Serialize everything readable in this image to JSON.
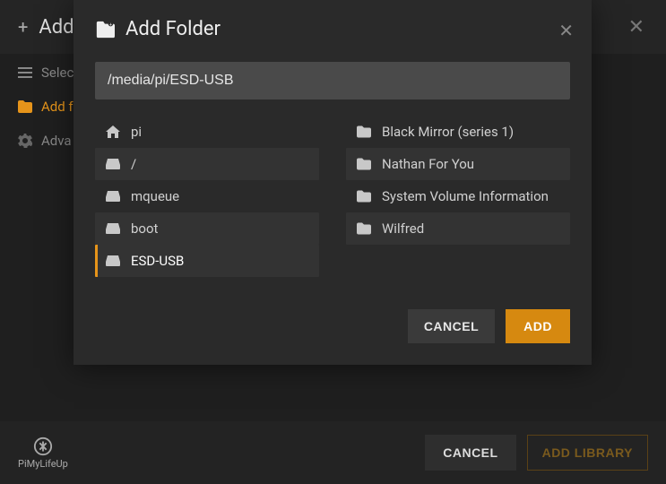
{
  "background": {
    "title": "Add",
    "steps": {
      "select": "Select",
      "add_folder": "Add f",
      "advanced": "Adva"
    },
    "cancel": "CANCEL",
    "add_library": "ADD LIBRARY",
    "logo_text": "PiMyLifeUp"
  },
  "modal": {
    "title": "Add Folder",
    "path": "/media/pi/ESD-USB",
    "drives": [
      {
        "icon": "home",
        "label": "pi"
      },
      {
        "icon": "drive",
        "label": "/"
      },
      {
        "icon": "drive",
        "label": "mqueue"
      },
      {
        "icon": "drive",
        "label": "boot"
      },
      {
        "icon": "drive",
        "label": "ESD-USB",
        "selected": true
      }
    ],
    "folders": [
      {
        "label": "Black Mirror (series 1)"
      },
      {
        "label": "Nathan For You"
      },
      {
        "label": "System Volume Information"
      },
      {
        "label": "Wilfred"
      }
    ],
    "cancel": "CANCEL",
    "add": "ADD"
  }
}
